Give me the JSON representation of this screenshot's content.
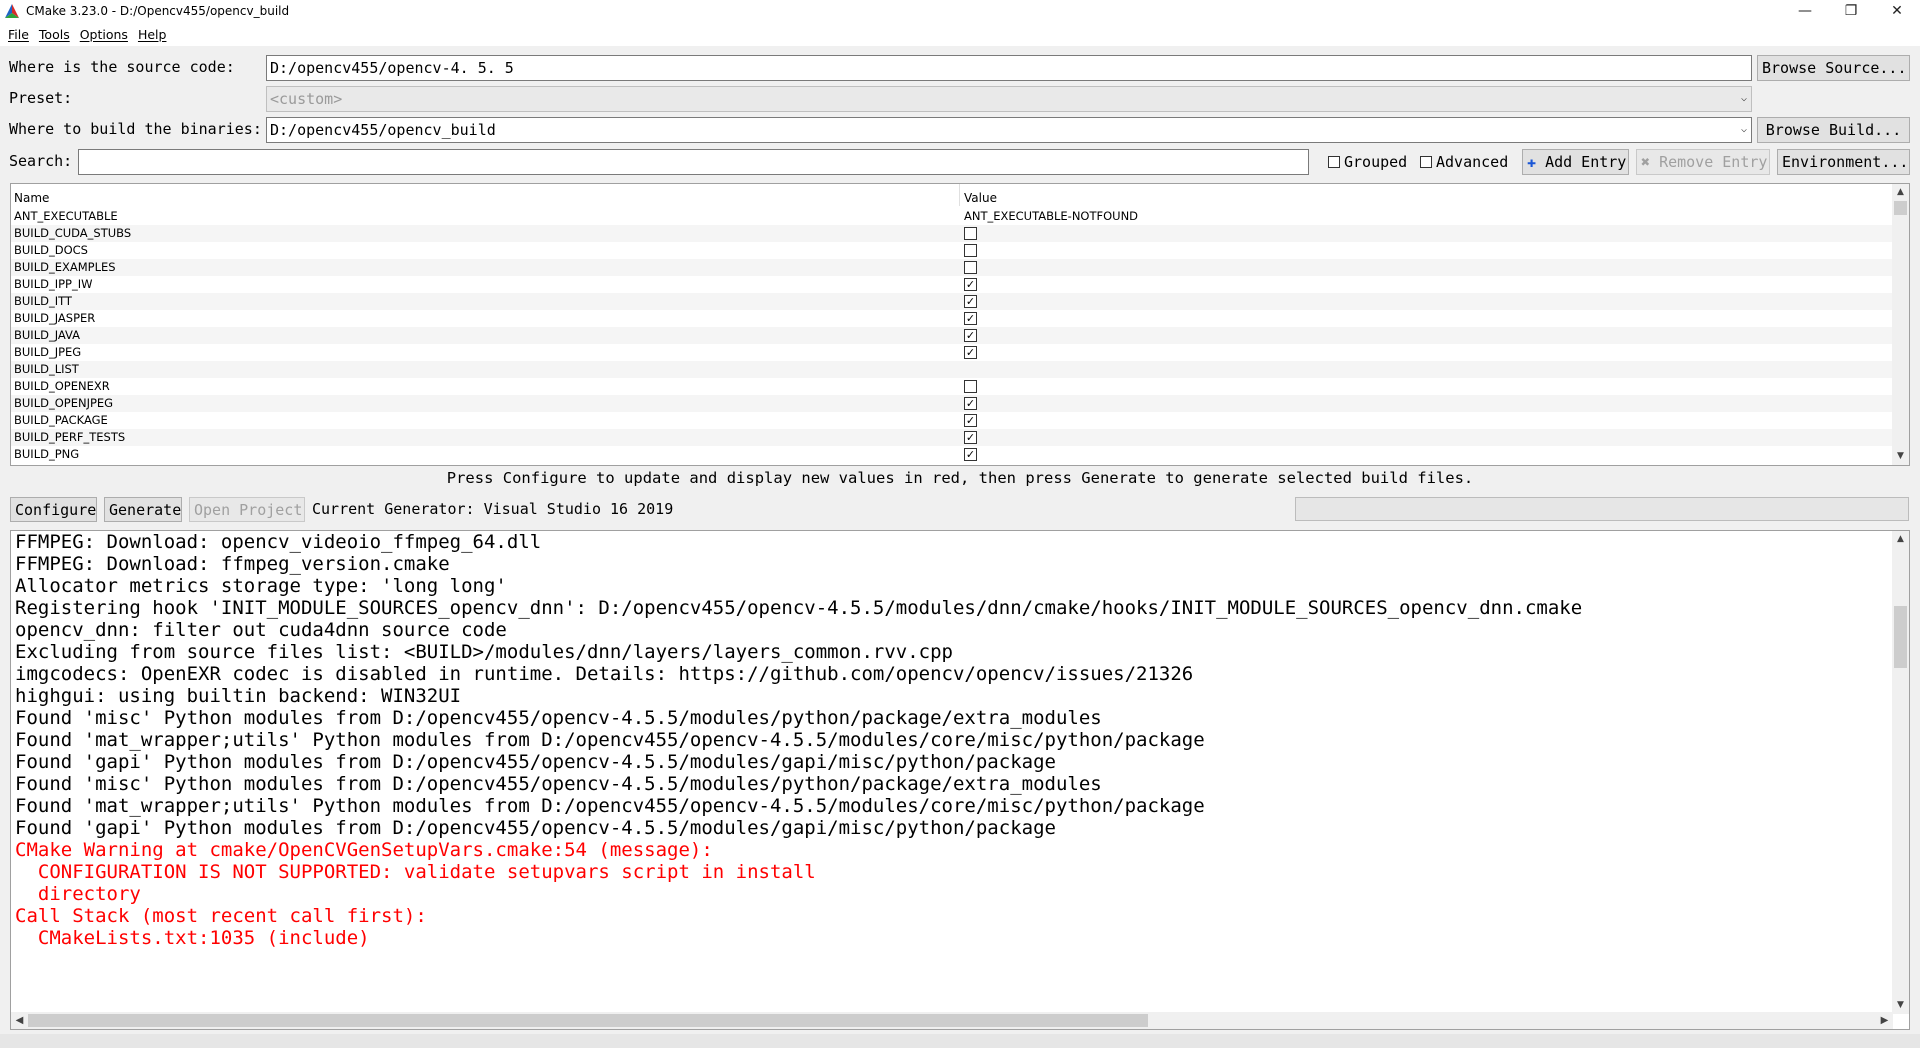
{
  "window": {
    "title": "CMake 3.23.0 - D:/Opencv455/opencv_build",
    "minimize_glyph": "—",
    "maximize_glyph": "❐",
    "close_glyph": "✕"
  },
  "menu": [
    "File",
    "Tools",
    "Options",
    "Help"
  ],
  "source": {
    "label": "Where is the source code:",
    "value": "D:/opencv455/opencv-4. 5. 5",
    "browse_label": "Browse Source..."
  },
  "preset": {
    "label": "Preset:",
    "value": "<custom>"
  },
  "build": {
    "label": "Where to build the binaries:",
    "value": "D:/opencv455/opencv_build",
    "browse_label": "Browse Build..."
  },
  "search": {
    "label": "Search:",
    "value": ""
  },
  "options": {
    "grouped_label": "Grouped",
    "advanced_label": "Advanced",
    "add_entry_label": "Add Entry",
    "remove_entry_label": "Remove Entry",
    "environment_label": "Environment..."
  },
  "cache_table": {
    "headers": {
      "name": "Name",
      "value": "Value"
    },
    "rows": [
      {
        "name": "ANT_EXECUTABLE",
        "type": "text",
        "value": "ANT_EXECUTABLE-NOTFOUND"
      },
      {
        "name": "BUILD_CUDA_STUBS",
        "type": "bool",
        "checked": false
      },
      {
        "name": "BUILD_DOCS",
        "type": "bool",
        "checked": false
      },
      {
        "name": "BUILD_EXAMPLES",
        "type": "bool",
        "checked": false
      },
      {
        "name": "BUILD_IPP_IW",
        "type": "bool",
        "checked": true
      },
      {
        "name": "BUILD_ITT",
        "type": "bool",
        "checked": true
      },
      {
        "name": "BUILD_JASPER",
        "type": "bool",
        "checked": true
      },
      {
        "name": "BUILD_JAVA",
        "type": "bool",
        "checked": true
      },
      {
        "name": "BUILD_JPEG",
        "type": "bool",
        "checked": true
      },
      {
        "name": "BUILD_LIST",
        "type": "text",
        "value": ""
      },
      {
        "name": "BUILD_OPENEXR",
        "type": "bool",
        "checked": false
      },
      {
        "name": "BUILD_OPENJPEG",
        "type": "bool",
        "checked": true
      },
      {
        "name": "BUILD_PACKAGE",
        "type": "bool",
        "checked": true
      },
      {
        "name": "BUILD_PERF_TESTS",
        "type": "bool",
        "checked": true
      },
      {
        "name": "BUILD_PNG",
        "type": "bool",
        "checked": true
      }
    ]
  },
  "hint": "Press Configure to update and display new values in red, then press Generate to generate selected build files.",
  "actions": {
    "configure_label": "Configure",
    "generate_label": "Generate",
    "open_project_label": "Open Project",
    "generator_text": "Current Generator: Visual Studio 16 2019"
  },
  "output_lines": [
    {
      "text": "FFMPEG: Download: opencv_videoio_ffmpeg_64.dll",
      "warn": false
    },
    {
      "text": "FFMPEG: Download: ffmpeg_version.cmake",
      "warn": false
    },
    {
      "text": "Allocator metrics storage type: 'long long'",
      "warn": false
    },
    {
      "text": "Registering hook 'INIT_MODULE_SOURCES_opencv_dnn': D:/opencv455/opencv-4.5.5/modules/dnn/cmake/hooks/INIT_MODULE_SOURCES_opencv_dnn.cmake",
      "warn": false
    },
    {
      "text": "opencv_dnn: filter out cuda4dnn source code",
      "warn": false
    },
    {
      "text": "Excluding from source files list: <BUILD>/modules/dnn/layers/layers_common.rvv.cpp",
      "warn": false
    },
    {
      "text": "imgcodecs: OpenEXR codec is disabled in runtime. Details: https://github.com/opencv/opencv/issues/21326",
      "warn": false
    },
    {
      "text": "highgui: using builtin backend: WIN32UI",
      "warn": false
    },
    {
      "text": "Found 'misc' Python modules from D:/opencv455/opencv-4.5.5/modules/python/package/extra_modules",
      "warn": false
    },
    {
      "text": "Found 'mat_wrapper;utils' Python modules from D:/opencv455/opencv-4.5.5/modules/core/misc/python/package",
      "warn": false
    },
    {
      "text": "Found 'gapi' Python modules from D:/opencv455/opencv-4.5.5/modules/gapi/misc/python/package",
      "warn": false
    },
    {
      "text": "Found 'misc' Python modules from D:/opencv455/opencv-4.5.5/modules/python/package/extra_modules",
      "warn": false
    },
    {
      "text": "Found 'mat_wrapper;utils' Python modules from D:/opencv455/opencv-4.5.5/modules/core/misc/python/package",
      "warn": false
    },
    {
      "text": "Found 'gapi' Python modules from D:/opencv455/opencv-4.5.5/modules/gapi/misc/python/package",
      "warn": false
    },
    {
      "text": "CMake Warning at cmake/OpenCVGenSetupVars.cmake:54 (message):",
      "warn": true
    },
    {
      "text": "  CONFIGURATION IS NOT SUPPORTED: validate setupvars script in install",
      "warn": true
    },
    {
      "text": "  directory",
      "warn": true
    },
    {
      "text": "Call Stack (most recent call first):",
      "warn": true
    },
    {
      "text": "  CMakeLists.txt:1035 (include)",
      "warn": true
    }
  ],
  "colors": {
    "warning_text": "#ff0000",
    "window_bg": "#f0f0f0"
  },
  "icons": {
    "app": "cmake-triangle-icon",
    "add_entry": "plus-icon",
    "remove_entry": "cross-icon"
  }
}
